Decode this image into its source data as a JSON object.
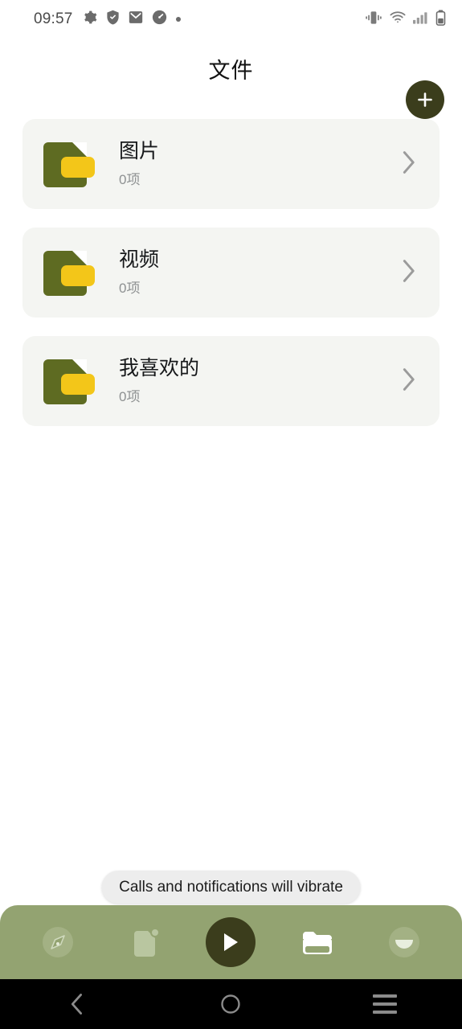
{
  "status_bar": {
    "time": "09:57",
    "left_icons": [
      "gear-icon",
      "shield-check-icon",
      "mail-icon",
      "speedometer-icon",
      "dot-icon"
    ],
    "right_icons": [
      "vibrate-icon",
      "wifi-icon",
      "signal-bars-icon",
      "battery-icon"
    ]
  },
  "app_bar": {
    "title": "文件",
    "add_button_label": "+"
  },
  "list": {
    "items": [
      {
        "title": "图片",
        "subtitle": "0项",
        "icon": "folder-icon",
        "chevron": "chevron-right-icon"
      },
      {
        "title": "视频",
        "subtitle": "0项",
        "icon": "folder-icon",
        "chevron": "chevron-right-icon"
      },
      {
        "title": "我喜欢的",
        "subtitle": "0项",
        "icon": "folder-icon",
        "chevron": "chevron-right-icon"
      }
    ]
  },
  "toast": {
    "message": "Calls and notifications will vibrate"
  },
  "bottom_bar": {
    "items": [
      {
        "name": "compass-icon",
        "active": false
      },
      {
        "name": "document-badge-icon",
        "active": false
      },
      {
        "name": "play-icon",
        "active": true
      },
      {
        "name": "folder-icon",
        "active": true
      },
      {
        "name": "profile-icon",
        "active": false
      }
    ]
  },
  "android_nav": {
    "back": "back-icon",
    "home": "home-icon",
    "recents": "recents-icon"
  },
  "colors": {
    "accent_dark": "#3B3D1C",
    "nav_green": "#93A371",
    "folder_green": "#5E6B22",
    "folder_yellow": "#F3C619",
    "card_bg": "#F4F5F2",
    "page_bg": "#FFFFFF"
  }
}
